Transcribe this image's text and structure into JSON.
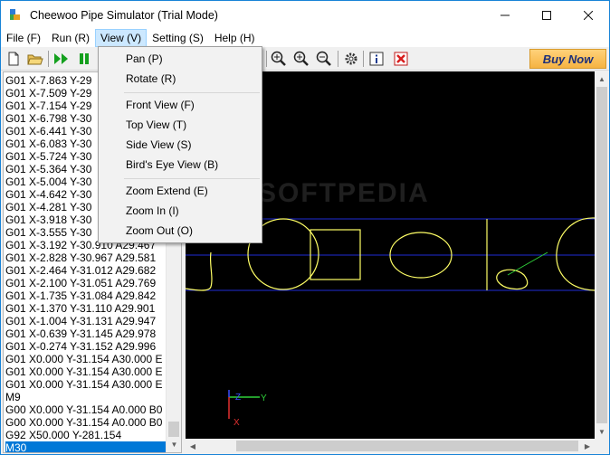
{
  "window": {
    "title": "Cheewoo Pipe Simulator (Trial Mode)",
    "controls": {
      "minimize": "—",
      "maximize": "☐",
      "close": "✕"
    }
  },
  "menubar": {
    "file": "File (F)",
    "run": "Run (R)",
    "view": "View (V)",
    "setting": "Setting (S)",
    "help": "Help (H)"
  },
  "toolbar": {
    "buy_now": "Buy Now",
    "icons": [
      "new-file-icon",
      "open-folder-icon",
      "fast-forward-icon",
      "pause-icon",
      "zoom-extend-icon",
      "zoom-in-icon",
      "zoom-out-icon",
      "settings-gear-icon",
      "info-icon",
      "close-red-icon"
    ]
  },
  "view_menu": {
    "pan": "Pan (P)",
    "rotate": "Rotate (R)",
    "front_view": "Front View (F)",
    "top_view": "Top View (T)",
    "side_view": "Side View (S)",
    "birds_eye_view": "Bird's Eye View (B)",
    "zoom_extend": "Zoom Extend (E)",
    "zoom_in": "Zoom In (I)",
    "zoom_out": "Zoom Out (O)"
  },
  "code_lines": [
    "G01 X-7.863 Y-29",
    "G01 X-7.509 Y-29",
    "G01 X-7.154 Y-29",
    "G01 X-6.798 Y-30",
    "G01 X-6.441 Y-30",
    "G01 X-6.083 Y-30",
    "G01 X-5.724 Y-30",
    "G01 X-5.364 Y-30",
    "G01 X-5.004 Y-30",
    "G01 X-4.642 Y-30",
    "G01 X-4.281 Y-30",
    "G01 X-3.918 Y-30",
    "G01 X-3.555 Y-30",
    "G01 X-3.192 Y-30.910 A29.467",
    "G01 X-2.828 Y-30.967 A29.581",
    "G01 X-2.464 Y-31.012 A29.682",
    "G01 X-2.100 Y-31.051 A29.769",
    "G01 X-1.735 Y-31.084 A29.842",
    "G01 X-1.370 Y-31.110 A29.901",
    "G01 X-1.004 Y-31.131 A29.947",
    "G01 X-0.639 Y-31.145 A29.978",
    "G01 X-0.274 Y-31.152 A29.996",
    "G01 X0.000 Y-31.154 A30.000 E",
    "G01 X0.000 Y-31.154 A30.000 E",
    "G01 X0.000 Y-31.154 A30.000 E",
    "M9",
    "G00 X0.000 Y-31.154 A0.000 B0",
    "G00 X0.000 Y-31.154 A0.000 B0",
    "G92 X50.000 Y-281.154",
    "M30"
  ],
  "watermark": "SOFTPEDIA",
  "axes": {
    "y_label": "Y",
    "z_label": "Z",
    "x_label": "X"
  },
  "colors": {
    "accent": "#0078d7",
    "viewport_bg": "#000000",
    "guide_line": "#1f2bd6",
    "pipe_profile": "#ffff66",
    "buy_button": "#f5b342"
  }
}
